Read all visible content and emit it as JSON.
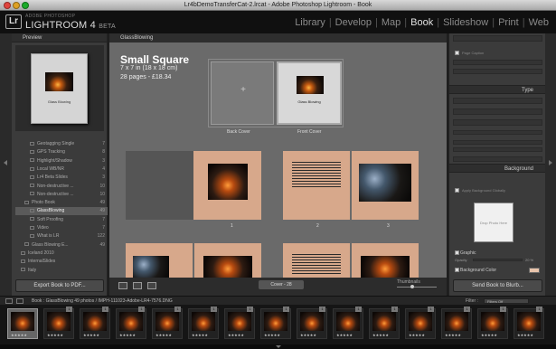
{
  "window": {
    "title": "Lr4bDemoTransferCat-2.lrcat - Adobe Photoshop Lightroom - Book"
  },
  "logo": {
    "mark": "Lr",
    "sub": "ADOBE PHOTOSHOP",
    "main": "LIGHTROOM 4",
    "beta": "BETA"
  },
  "modules": [
    "Library",
    "Develop",
    "Map",
    "Book",
    "Slideshow",
    "Print",
    "Web"
  ],
  "modules_active": "Book",
  "left_panel": {
    "preview_header": "Preview",
    "preview_label": "Glass Blowing",
    "collections": [
      {
        "label": "Geotagging Single",
        "count": "7"
      },
      {
        "label": "GPS Tracking",
        "count": "8"
      },
      {
        "label": "Highlight/Shadow",
        "count": "3"
      },
      {
        "label": "Local WB/NR",
        "count": "4"
      },
      {
        "label": "Lr4 Beta Slides",
        "count": "3"
      },
      {
        "label": "Non-destructive ...",
        "count": "10"
      },
      {
        "label": "Non-destructive ...",
        "count": "10"
      },
      {
        "label": "Photo Book",
        "count": "49"
      },
      {
        "label": "GlassBlowing",
        "count": "49"
      },
      {
        "label": "Soft Proofing",
        "count": "7"
      },
      {
        "label": "Video",
        "count": "7"
      },
      {
        "label": "What is LR",
        "count": "122"
      },
      {
        "label": "Glass Blowing E...",
        "count": "49"
      },
      {
        "label": "Iceland 2010",
        "count": ""
      },
      {
        "label": "InternalSlides",
        "count": ""
      },
      {
        "label": "Italy",
        "count": ""
      }
    ],
    "export_button": "Export Book to PDF..."
  },
  "center": {
    "header": "GlassBlowing",
    "book_title": "Small Square",
    "book_dim": "7 x 7 in (18 x 18 cm)",
    "book_pages": "28 pages - £18.34",
    "cover_labels": {
      "back": "Back Cover",
      "front": "Front Cover"
    },
    "front_cover_text": "Glass Blowing",
    "page_numbers": [
      "1",
      "2",
      "3"
    ],
    "bottom": {
      "cover_button": "Cover - 28",
      "thumbnails_label": "Thumbnails"
    }
  },
  "right_panel": {
    "page_caption": "Page Caption",
    "type_header": "Type",
    "background_header": "Background",
    "use_background": "Apply Background Globally",
    "drop_photo": "Drop Photo Here",
    "graphic": "Graphic",
    "opacity_label": "Opacity",
    "opacity_value": "20 %",
    "background_color": "Background Color",
    "send_button": "Send Book to Blurb..."
  },
  "filmstrip_bar": {
    "info": "Book : GlassBlowing   49 photos / IMPH-111023-Adobe-LR4-7576.DNG",
    "filter_label": "Filter :",
    "filter_value": "Filters Off"
  },
  "film_thumbs": [
    {
      "stars": "★★★★★",
      "badge": ""
    },
    {
      "stars": "★★★★★",
      "badge": "1"
    },
    {
      "stars": "★★★★★",
      "badge": "1"
    },
    {
      "stars": "★★★★★",
      "badge": "1"
    },
    {
      "stars": "★★★★★",
      "badge": "1"
    },
    {
      "stars": "★★★★★",
      "badge": "1"
    },
    {
      "stars": "★★★★★",
      "badge": "1"
    },
    {
      "stars": "★★★★★",
      "badge": "1"
    },
    {
      "stars": "★★★★★",
      "badge": "1"
    },
    {
      "stars": "★★★★★",
      "badge": "1"
    },
    {
      "stars": "★★★★★",
      "badge": "1"
    },
    {
      "stars": "★★★★★",
      "badge": "1"
    },
    {
      "stars": "★★★★★",
      "badge": "1"
    },
    {
      "stars": "★★★★★",
      "badge": "1"
    },
    {
      "stars": "★★★★★",
      "badge": "1"
    }
  ],
  "colors": {
    "accent": "#e2e2e2",
    "page": "#d7a88b",
    "selected_row": "#5a5a5a"
  }
}
